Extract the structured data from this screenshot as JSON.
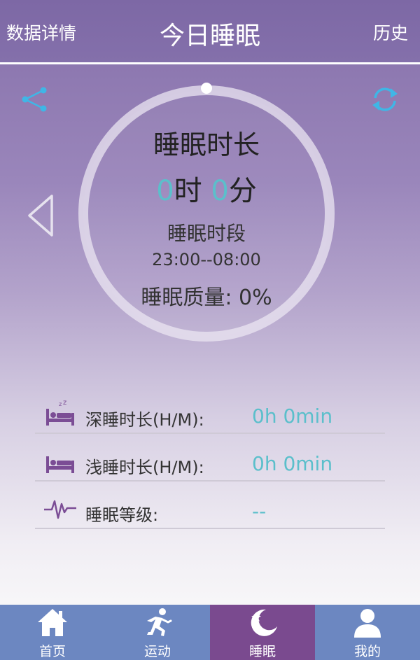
{
  "header": {
    "left_link": "数据详情",
    "title": "今日睡眠",
    "right_link": "历史"
  },
  "summary": {
    "duration_label": "睡眠时长",
    "hours_value": "0",
    "hours_unit": "时",
    "minutes_value": "0",
    "minutes_unit": "分",
    "period_label": "睡眠时段",
    "period_value": "23:00--08:00",
    "quality_text": "睡眠质量: 0%"
  },
  "stats": [
    {
      "label": "深睡时长(H/M):",
      "value": "0h 0min",
      "icon": "deep-sleep-bed-icon"
    },
    {
      "label": "浅睡时长(H/M):",
      "value": "0h 0min",
      "icon": "light-sleep-bed-icon"
    },
    {
      "label": "睡眠等级:",
      "value": "--",
      "icon": "heartbeat-icon"
    }
  ],
  "tabs": [
    {
      "label": "首页",
      "icon": "home-icon"
    },
    {
      "label": "运动",
      "icon": "running-icon"
    },
    {
      "label": "睡眠",
      "icon": "moon-star-icon",
      "active": true
    },
    {
      "label": "我的",
      "icon": "user-icon"
    }
  ],
  "colors": {
    "accent": "#5bbfcb",
    "tabbar": "#6c87c1",
    "tab_active": "#7a4a8f",
    "icon_purple": "#7b4d95",
    "share_refresh_blue": "#3fb6e6"
  }
}
